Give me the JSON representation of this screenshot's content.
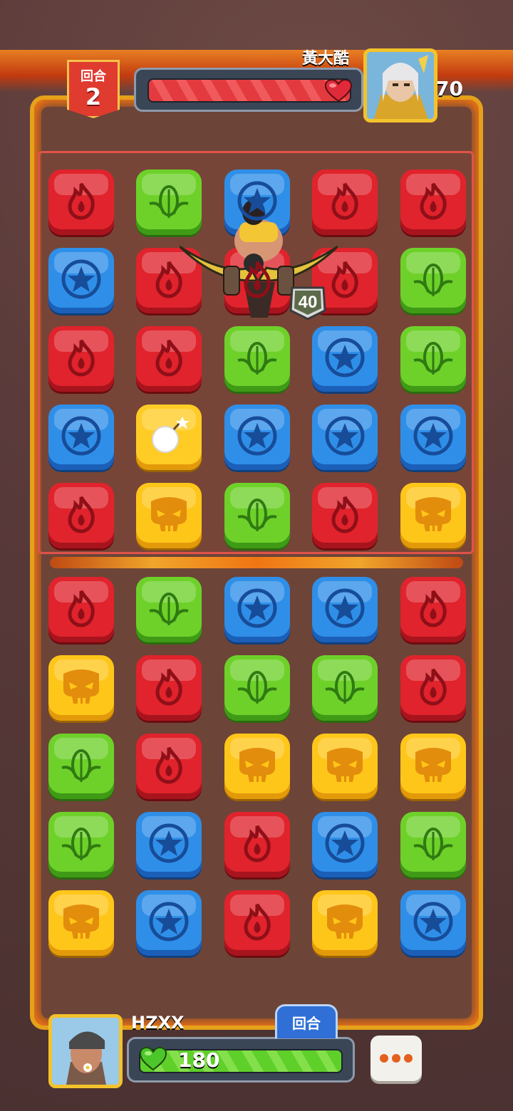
{
  "round": {
    "label": "回合",
    "number": "2"
  },
  "enemy": {
    "name": "黃大酷",
    "hp": "270"
  },
  "player": {
    "name": "HZXX",
    "hp": "180"
  },
  "turn_tab": "回合",
  "hero_level": "40",
  "colors": {
    "fire": "#e0232c",
    "leaf": "#6ed12a",
    "star": "#2f8fe8",
    "skull": "#ffc61a"
  },
  "board": [
    [
      "fire",
      "leaf",
      "star",
      "fire",
      "fire"
    ],
    [
      "star",
      "fire",
      "fire",
      "fire",
      "leaf"
    ],
    [
      "fire",
      "fire",
      "leaf",
      "star",
      "leaf"
    ],
    [
      "star",
      "bomb",
      "star",
      "star",
      "star"
    ],
    [
      "fire",
      "skull",
      "leaf",
      "fire",
      "skull"
    ],
    [
      "fire",
      "leaf",
      "star",
      "star",
      "fire"
    ],
    [
      "skull",
      "fire",
      "leaf",
      "leaf",
      "fire"
    ],
    [
      "leaf",
      "fire",
      "skull",
      "skull",
      "skull"
    ],
    [
      "leaf",
      "star",
      "fire",
      "star",
      "leaf"
    ],
    [
      "skull",
      "star",
      "fire",
      "skull",
      "star"
    ]
  ]
}
